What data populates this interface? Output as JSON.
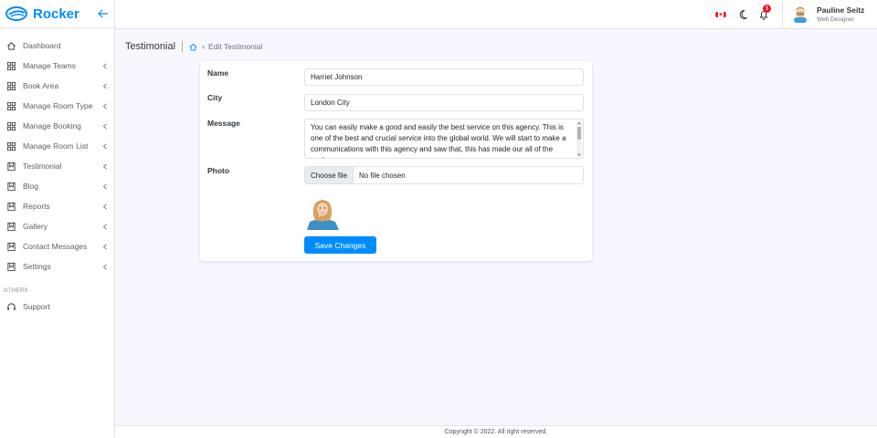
{
  "brand": {
    "name": "Rocker",
    "color": "#008cff"
  },
  "sidebar": {
    "items": [
      {
        "label": "Dashboard",
        "icon": "home-icon",
        "caret": false
      },
      {
        "label": "Manage Teams",
        "icon": "grid-icon",
        "caret": true
      },
      {
        "label": "Book Area",
        "icon": "grid-icon",
        "caret": true
      },
      {
        "label": "Manage Room Type",
        "icon": "grid-icon",
        "caret": true
      },
      {
        "label": "Manage Booking",
        "icon": "grid-icon",
        "caret": true
      },
      {
        "label": "Manage Room List",
        "icon": "grid-icon",
        "caret": true
      },
      {
        "label": "Testimonial",
        "icon": "bookmark-icon",
        "caret": true
      },
      {
        "label": "Blog",
        "icon": "bookmark-icon",
        "caret": true
      },
      {
        "label": "Reports",
        "icon": "bookmark-icon",
        "caret": true
      },
      {
        "label": "Gallery",
        "icon": "bookmark-icon",
        "caret": true
      },
      {
        "label": "Contact Messages",
        "icon": "bookmark-icon",
        "caret": true
      },
      {
        "label": "Settings",
        "icon": "bookmark-icon",
        "caret": true
      }
    ],
    "section_others": "OTHERS",
    "support_label": "Support"
  },
  "topbar": {
    "notification_count": "1",
    "user_name": "Pauline Seitz",
    "user_role": "Web Designer"
  },
  "breadcrumb": {
    "title": "Testimonial",
    "current": "Edit Testimonial"
  },
  "form": {
    "name_label": "Name",
    "name_value": "Harriet Johnson",
    "city_label": "City",
    "city_value": "London City",
    "message_label": "Message",
    "message_value": "You can easily make a good and easily the best service on this agency. This is one of the best and crucial service into the global world. We will start to make a communications  with this agency and saw that, this has made our all of the work",
    "photo_label": "Photo",
    "file_button": "Choose file",
    "file_status": "No file chosen",
    "save_label": "Save Changes"
  },
  "footer": {
    "text": "Copyright © 2022. All right reserved."
  }
}
